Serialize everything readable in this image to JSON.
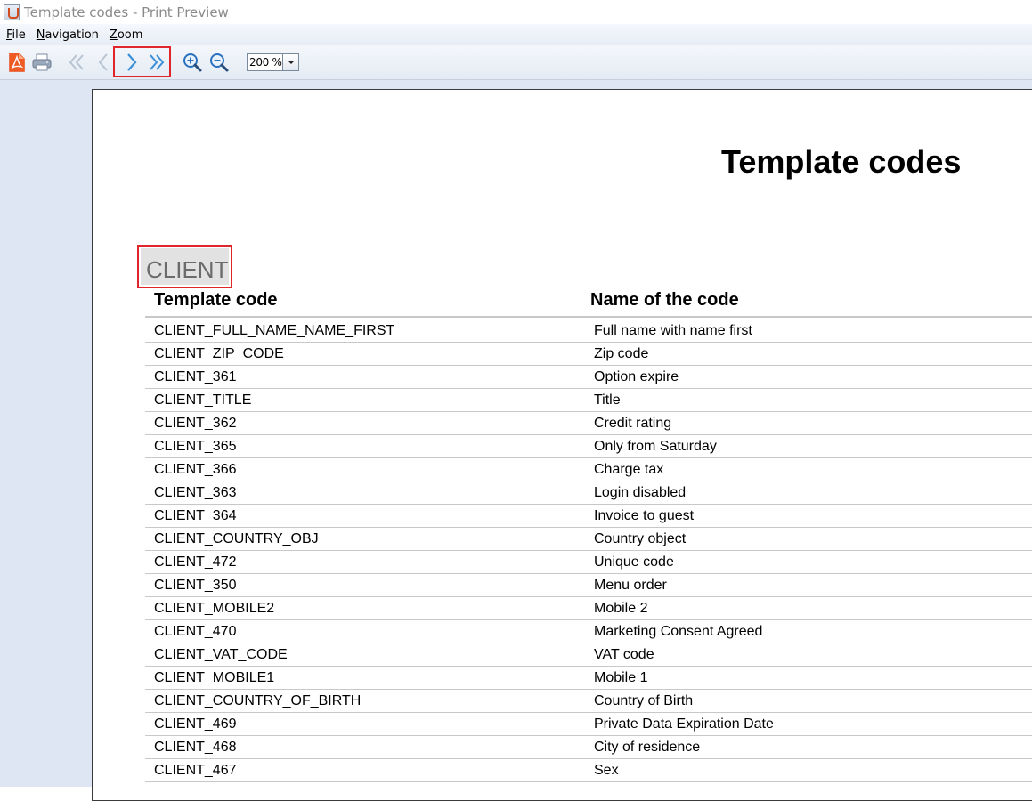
{
  "window": {
    "title": "Template codes - Print Preview"
  },
  "menu": [
    {
      "mnemonic": "F",
      "rest": "ile"
    },
    {
      "mnemonic": "N",
      "rest": "avigation"
    },
    {
      "mnemonic": "Z",
      "rest": "oom"
    }
  ],
  "toolbar": {
    "icons": [
      "pdf-export-icon",
      "print-icon",
      "first-page-icon",
      "previous-page-icon",
      "next-page-icon",
      "last-page-icon",
      "zoom-in-icon",
      "zoom-out-icon"
    ],
    "zoom": "200 %"
  },
  "colors": {
    "highlight": "#e0262b",
    "nav_active": "#3a8fd8",
    "nav_disabled": "#b8c4d2"
  },
  "document": {
    "title": "Template codes",
    "section": "CLIENT",
    "columns": {
      "code": "Template code",
      "name": "Name of the code"
    },
    "rows": [
      {
        "code": "CLIENT_FULL_NAME_NAME_FIRST",
        "name": "Full name with name first"
      },
      {
        "code": "CLIENT_ZIP_CODE",
        "name": "Zip code"
      },
      {
        "code": "CLIENT_361",
        "name": "Option expire"
      },
      {
        "code": "CLIENT_TITLE",
        "name": "Title"
      },
      {
        "code": "CLIENT_362",
        "name": "Credit rating"
      },
      {
        "code": "CLIENT_365",
        "name": "Only from Saturday"
      },
      {
        "code": "CLIENT_366",
        "name": "Charge tax"
      },
      {
        "code": "CLIENT_363",
        "name": "Login disabled"
      },
      {
        "code": "CLIENT_364",
        "name": "Invoice to guest"
      },
      {
        "code": "CLIENT_COUNTRY_OBJ",
        "name": "Country object"
      },
      {
        "code": "CLIENT_472",
        "name": "Unique code"
      },
      {
        "code": "CLIENT_350",
        "name": "Menu order"
      },
      {
        "code": "CLIENT_MOBILE2",
        "name": "Mobile 2"
      },
      {
        "code": "CLIENT_470",
        "name": "Marketing Consent Agreed"
      },
      {
        "code": "CLIENT_VAT_CODE",
        "name": "VAT code"
      },
      {
        "code": "CLIENT_MOBILE1",
        "name": "Mobile 1"
      },
      {
        "code": "CLIENT_COUNTRY_OF_BIRTH",
        "name": "Country of Birth"
      },
      {
        "code": "CLIENT_469",
        "name": "Private Data Expiration Date"
      },
      {
        "code": "CLIENT_468",
        "name": "City of residence"
      },
      {
        "code": "CLIENT_467",
        "name": "Sex"
      }
    ]
  }
}
